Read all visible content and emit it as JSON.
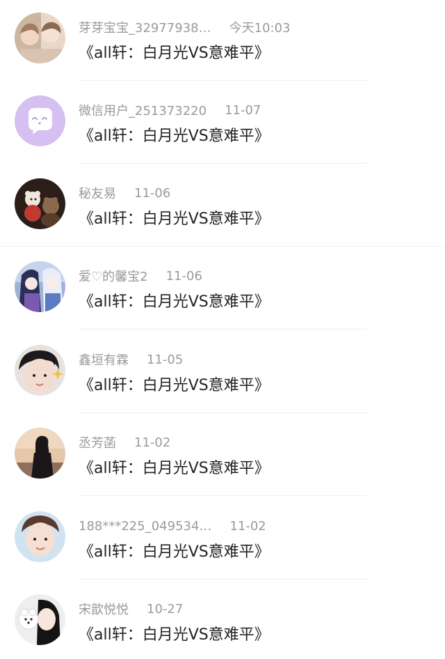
{
  "colors": {
    "username": "#9a9a9a",
    "title": "#222222",
    "divider": "#efefef",
    "wechat_avatar_bg": "#d6bff1"
  },
  "list": [
    {
      "username": "芽芽宝宝_32977938…",
      "time": "今天10:03",
      "book_title": "《all轩：白月光VS意难平》",
      "avatar": "photo-two-people"
    },
    {
      "username": "微信用户_251373220",
      "time": "11-07",
      "book_title": "《all轩：白月光VS意难平》",
      "avatar": "wechat-default-chat-icon"
    },
    {
      "username": "秘友易",
      "time": "11-06",
      "book_title": "《all轩：白月光VS意难平》",
      "avatar": "photo-plush-toys"
    },
    {
      "username": "爱♡的馨宝2",
      "time": "11-06",
      "book_title": "《all轩：白月光VS意难平》",
      "avatar": "anime-illustration"
    },
    {
      "username": "鑫垣有霖",
      "time": "11-05",
      "book_title": "《all轩：白月光VS意难平》",
      "avatar": "photo-person-sparkle"
    },
    {
      "username": "丞芳菡",
      "time": "11-02",
      "book_title": "《all轩：白月光VS意难平》",
      "avatar": "photo-person-sunset"
    },
    {
      "username": "188***225_049534…",
      "time": "11-02",
      "book_title": "《all轩：白月光VS意难平》",
      "avatar": "photo-young-man"
    },
    {
      "username": "宋歆悦悦",
      "time": "10-27",
      "book_title": "《all轩：白月光VS意难平》",
      "avatar": "photo-girl-dog"
    }
  ]
}
